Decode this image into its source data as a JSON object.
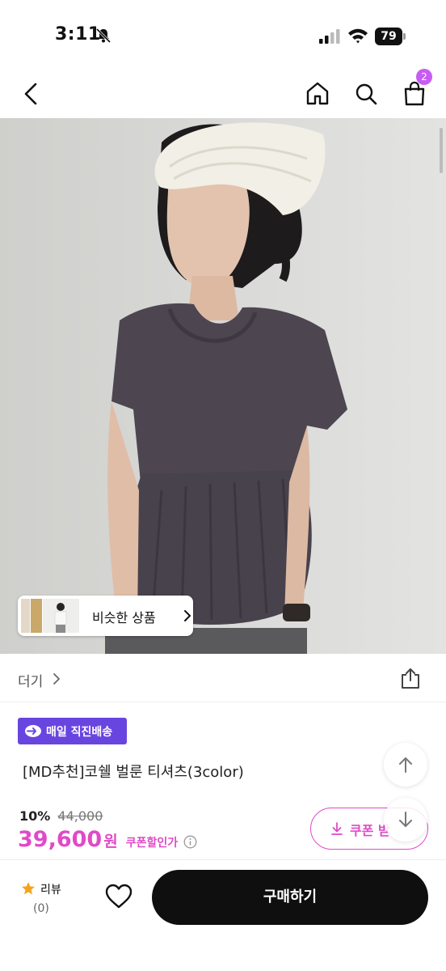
{
  "status_bar": {
    "time": "3:11",
    "battery": "79"
  },
  "nav": {
    "cart_count": "2"
  },
  "similar": {
    "label": "비슷한 상품"
  },
  "more": {
    "label": "더기"
  },
  "delivery": {
    "label": "매일 직진배송",
    "color": "#6945e0"
  },
  "product": {
    "title": "[MD추천]코쉘 벌룬 티셔츠(3color)",
    "discount_rate": "10%",
    "original_price": "44,000",
    "sale_price": "39,600",
    "sale_unit": "원",
    "coupon_price_label": "쿠폰할인가"
  },
  "coupon_button": {
    "label": "쿠폰 받"
  },
  "bottom": {
    "review_label": "리뷰",
    "review_count": "(0)",
    "buy_label": "구매하기"
  },
  "colors": {
    "accent": "#e04ac8",
    "badge": "#c85cf2",
    "buy": "#0f0f0f"
  },
  "icons": [
    "back-icon",
    "home-icon",
    "search-icon",
    "shopping-bag-icon",
    "share-icon",
    "download-icon",
    "arrow-up-icon",
    "arrow-down-icon",
    "star-icon",
    "heart-icon",
    "info-icon"
  ]
}
